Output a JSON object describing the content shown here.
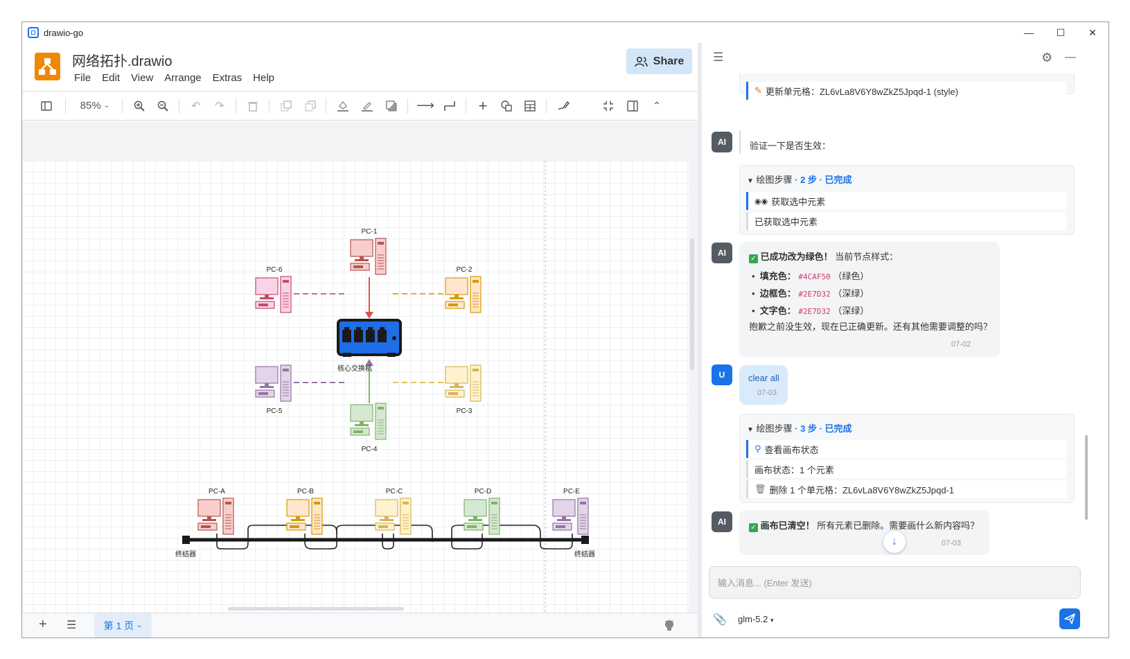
{
  "window": {
    "title": "drawio-go"
  },
  "app": {
    "filename": "网络拓扑.drawio",
    "menu": [
      "File",
      "Edit",
      "View",
      "Arrange",
      "Extras",
      "Help"
    ],
    "share_label": "Share",
    "zoom": "85%",
    "page_tab": "第 1 页"
  },
  "diagram": {
    "star_labels": [
      "PC-1",
      "PC-2",
      "PC-3",
      "PC-4",
      "PC-5",
      "PC-6"
    ],
    "switch_label": "核心交换机",
    "bus_labels": [
      "PC-A",
      "PC-B",
      "PC-C",
      "PC-D",
      "PC-E"
    ],
    "terminator_label": "终结器"
  },
  "chat": {
    "update_cell": "更新单元格：ZL6vLa8V6Y8wZkZ5Jpqd-1 (style)",
    "verify_text": "验证一下是否生效：",
    "steps1": {
      "prefix": "绘图步骤",
      "suffix": "· 2 步 · 已完成",
      "items": [
        "获取选中元素",
        "已获取选中元素"
      ]
    },
    "msg_success": {
      "title": "已成功改为绿色！",
      "title_rest": "当前节点样式：",
      "rows": [
        {
          "key": "填充色：",
          "code": "#4CAF50",
          "note": "（绿色）"
        },
        {
          "key": "边框色：",
          "code": "#2E7D32",
          "note": "（深绿）"
        },
        {
          "key": "文字色：",
          "code": "#2E7D32",
          "note": "（深绿）"
        }
      ],
      "para": "抱歉之前没生效，现在已正确更新。还有其他需要调整的吗？",
      "time": "07-02"
    },
    "user_msg": {
      "text": "clear all",
      "time": "07-03"
    },
    "steps2": {
      "prefix": "绘图步骤",
      "suffix": "· 3 步 · 已完成",
      "items": [
        "查看画布状态",
        "画布状态：1 个元素",
        "删除 1 个单元格：ZL6vLa8V6Y8wZkZ5Jpqd-1"
      ]
    },
    "msg_clear": {
      "title": "画布已清空！",
      "text": "所有元素已删除。需要画什么新内容吗？",
      "time": "07-03"
    },
    "input_placeholder": "输入消息... (Enter 发送)",
    "model": "glm-5.2"
  },
  "avatars": {
    "ai": "AI",
    "user": "U"
  },
  "colors": {
    "accent": "#1a73e8",
    "drawio_orange": "#f08705",
    "red": "#b85450",
    "orange": "#d79b00",
    "yellow": "#d6b656",
    "green": "#82b366",
    "purple": "#9673a6"
  }
}
